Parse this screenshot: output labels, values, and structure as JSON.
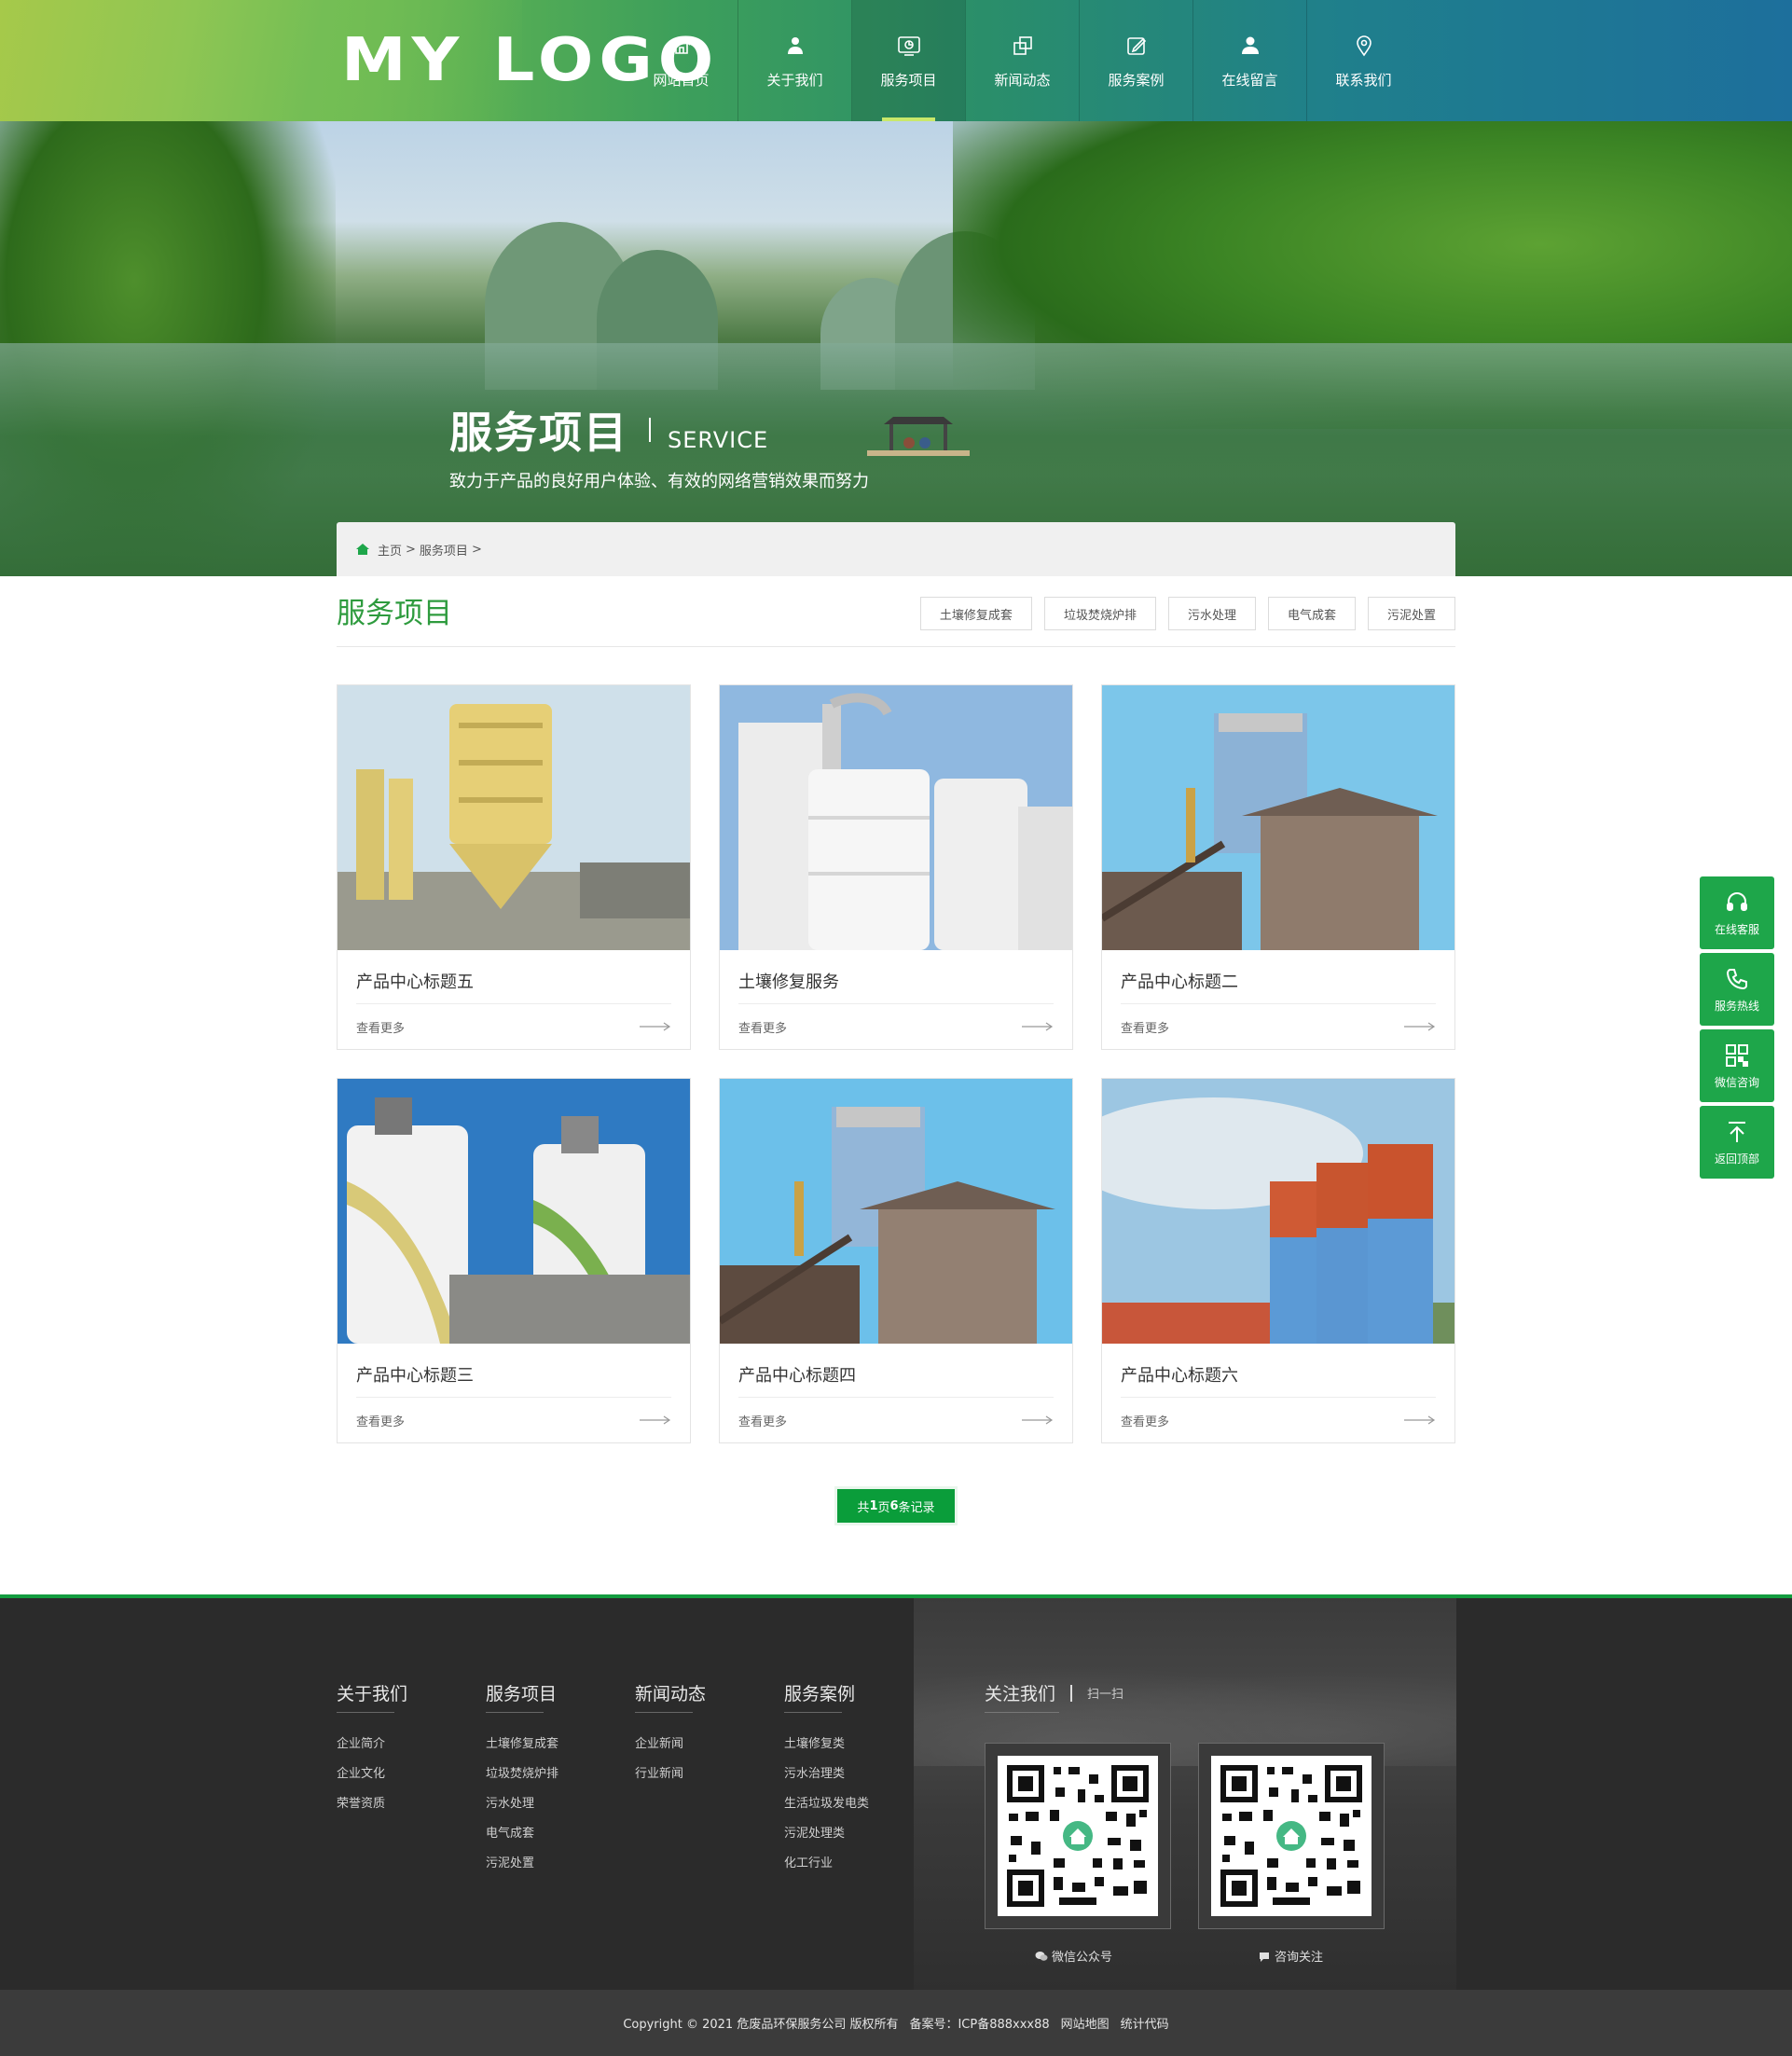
{
  "header": {
    "logo": "MY LOGO",
    "nav": [
      {
        "label": "网站首页",
        "icon": "home-icon"
      },
      {
        "label": "关于我们",
        "icon": "user-icon"
      },
      {
        "label": "服务项目",
        "icon": "chart-icon",
        "active": true
      },
      {
        "label": "新闻动态",
        "icon": "windows-icon"
      },
      {
        "label": "服务案例",
        "icon": "edit-icon"
      },
      {
        "label": "在线留言",
        "icon": "person-icon"
      },
      {
        "label": "联系我们",
        "icon": "location-icon"
      }
    ]
  },
  "banner": {
    "title_zh": "服务项目",
    "title_en": "SERVICE",
    "subtitle": "致力于产品的良好用户体验、有效的网络营销效果而努力"
  },
  "breadcrumb": {
    "home": "主页",
    "sep": ">",
    "current": "服务项目",
    "trail": ">"
  },
  "section": {
    "title": "服务项目",
    "tabs": [
      "土壤修复成套",
      "垃圾焚烧炉排",
      "污水处理",
      "电气成套",
      "污泥处置"
    ]
  },
  "cards": [
    {
      "title": "产品中心标题五",
      "more": "查看更多"
    },
    {
      "title": "土壤修复服务",
      "more": "查看更多"
    },
    {
      "title": "产品中心标题二",
      "more": "查看更多"
    },
    {
      "title": "产品中心标题三",
      "more": "查看更多"
    },
    {
      "title": "产品中心标题四",
      "more": "查看更多"
    },
    {
      "title": "产品中心标题六",
      "more": "查看更多"
    }
  ],
  "pager": {
    "prefix": "共 ",
    "pages": "1",
    "mid": "页",
    "records": "6",
    "suffix": "条记录"
  },
  "side_tools": [
    {
      "label": "在线客服",
      "icon": "headset-icon"
    },
    {
      "label": "服务热线",
      "icon": "phone-icon"
    },
    {
      "label": "微信咨询",
      "icon": "qrcode-icon"
    },
    {
      "label": "返回顶部",
      "icon": "arrow-up-icon"
    }
  ],
  "footer": {
    "columns": [
      {
        "title": "关于我们",
        "links": [
          "企业简介",
          "企业文化",
          "荣誉资质"
        ]
      },
      {
        "title": "服务项目",
        "links": [
          "土壤修复成套",
          "垃圾焚烧炉排",
          "污水处理",
          "电气成套",
          "污泥处置"
        ]
      },
      {
        "title": "新闻动态",
        "links": [
          "企业新闻",
          "行业新闻"
        ]
      },
      {
        "title": "服务案例",
        "links": [
          "土壤修复类",
          "污水治理类",
          "生活垃圾发电类",
          "污泥处理类",
          "化工行业"
        ]
      }
    ],
    "follow_title": "关注我们",
    "follow_sub": "扫一扫",
    "qr_captions": [
      "微信公众号",
      "咨询关注"
    ],
    "copyright": "Copyright © 2021 危废品环保服务公司 版权所有",
    "icp": "备案号：ICP备888xxx88",
    "sitemap": "网站地图",
    "stats": "统计代码"
  },
  "colors": {
    "accent": "#2e9b3e",
    "button": "#0a9d3a",
    "side_tool": "#1ea64a",
    "footer_bg": "#2b2b2b"
  }
}
